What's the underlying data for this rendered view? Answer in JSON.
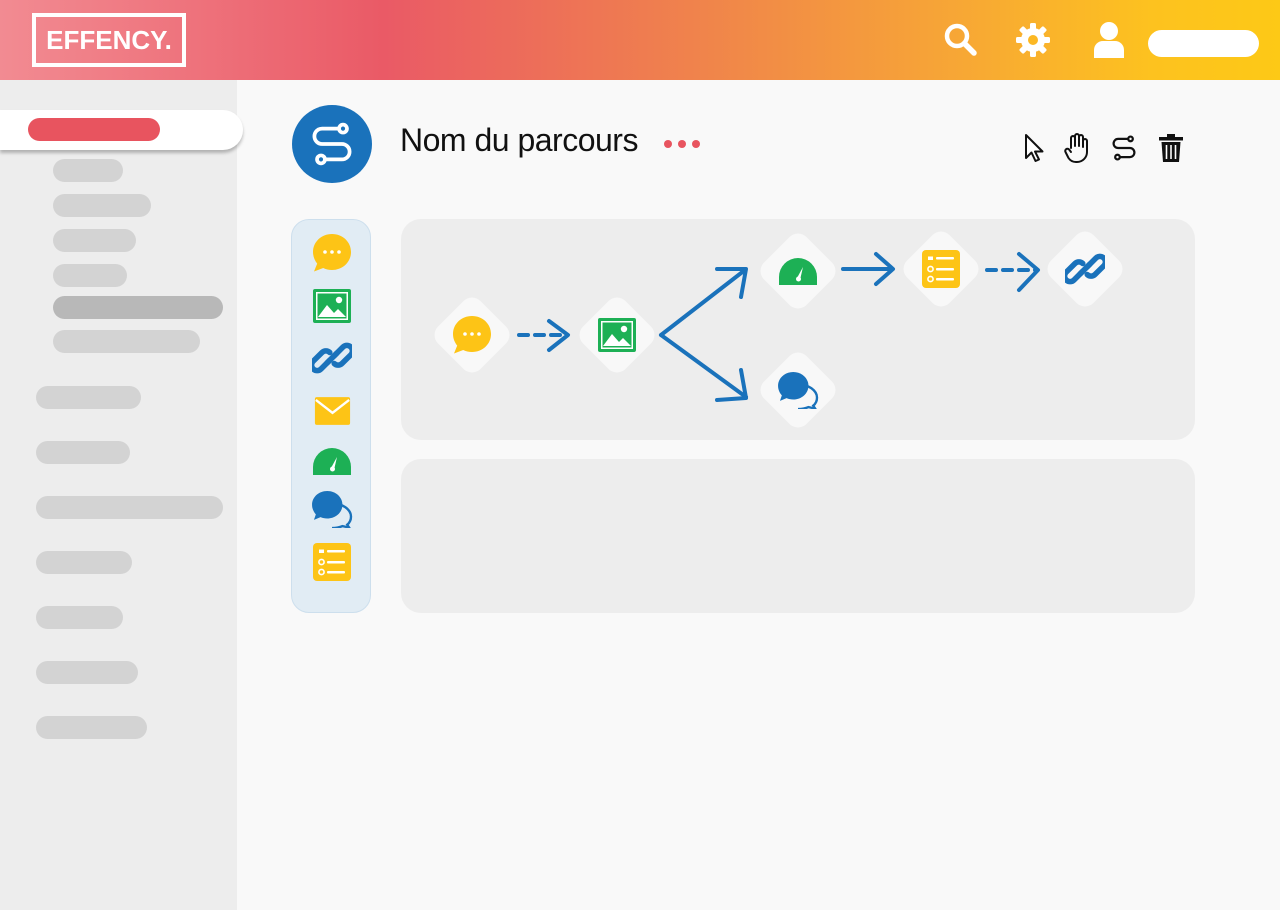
{
  "header": {
    "logo_text": "EFFENCY.",
    "icons": [
      "search-icon",
      "settings-gear-icon",
      "user-icon"
    ]
  },
  "sidebar": {
    "active_item_color": "#e8545f",
    "items_count_note": ""
  },
  "main": {
    "title": "Nom du parcours",
    "toolbar": [
      "pointer-cursor-icon",
      "hand-pan-icon",
      "route-icon",
      "trash-icon"
    ]
  },
  "palette": {
    "items": [
      "chat-bubble-icon",
      "image-icon",
      "link-icon",
      "envelope-icon",
      "gauge-icon",
      "conversation-icon",
      "checklist-icon"
    ]
  },
  "flow": {
    "nodes": [
      "chat-bubble",
      "image",
      "gauge",
      "checklist",
      "link",
      "conversation"
    ],
    "edges": [
      {
        "from": "chat-bubble",
        "to": "image",
        "style": "dashed"
      },
      {
        "from": "image",
        "to": "gauge",
        "style": "solid"
      },
      {
        "from": "image",
        "to": "conversation",
        "style": "solid"
      },
      {
        "from": "gauge",
        "to": "checklist",
        "style": "solid"
      },
      {
        "from": "checklist",
        "to": "link",
        "style": "dashed"
      }
    ]
  },
  "colors": {
    "brand_blue": "#1a72bb",
    "brand_yellow": "#fdc416",
    "brand_green": "#1db055",
    "brand_red": "#e8545f"
  }
}
